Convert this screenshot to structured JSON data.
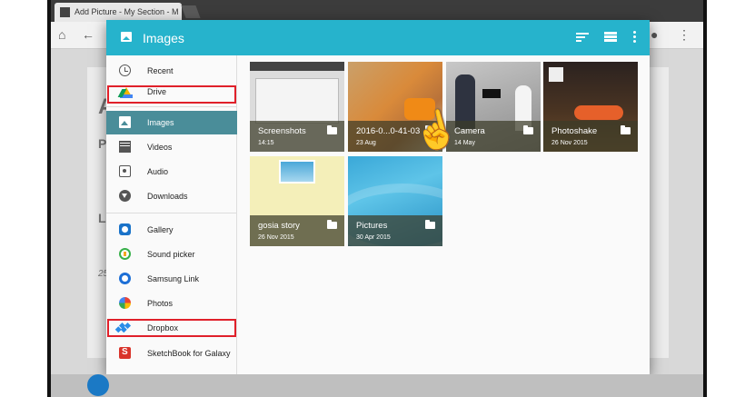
{
  "browser": {
    "tab_title": "Add Picture - My Section - M",
    "tab_close": "×"
  },
  "background": {
    "heading_letter": "A",
    "label_p": "P",
    "label_la": "La",
    "label_25": "25"
  },
  "dialog": {
    "title": "Images",
    "sidebar": [
      {
        "label": "Recent",
        "icon": "clock-icon"
      },
      {
        "label": "Drive",
        "icon": "google-drive-icon",
        "highlighted": true
      },
      {
        "label": "Images",
        "icon": "image-icon",
        "selected": true
      },
      {
        "label": "Videos",
        "icon": "video-icon"
      },
      {
        "label": "Audio",
        "icon": "audio-icon"
      },
      {
        "label": "Downloads",
        "icon": "download-icon"
      },
      {
        "label": "Gallery",
        "icon": "gallery-icon"
      },
      {
        "label": "Sound picker",
        "icon": "sound-picker-icon"
      },
      {
        "label": "Samsung Link",
        "icon": "samsung-link-icon"
      },
      {
        "label": "Photos",
        "icon": "google-photos-icon"
      },
      {
        "label": "Dropbox",
        "icon": "dropbox-icon",
        "highlighted": true
      },
      {
        "label": "SketchBook for Galaxy",
        "icon": "sketchbook-icon"
      }
    ],
    "folders": [
      {
        "name": "Screenshots",
        "date": "14:15"
      },
      {
        "name": "2016-0...0-41-03",
        "date": "23 Aug"
      },
      {
        "name": "Camera",
        "date": "14 May"
      },
      {
        "name": "Photoshake",
        "date": "26 Nov 2015"
      },
      {
        "name": "gosia story",
        "date": "26 Nov 2015"
      },
      {
        "name": "Pictures",
        "date": "30 Apr 2015"
      }
    ]
  },
  "colors": {
    "appbar": "#26b3cc",
    "selected": "#4a8d99",
    "highlight_box": "#e0202a"
  }
}
